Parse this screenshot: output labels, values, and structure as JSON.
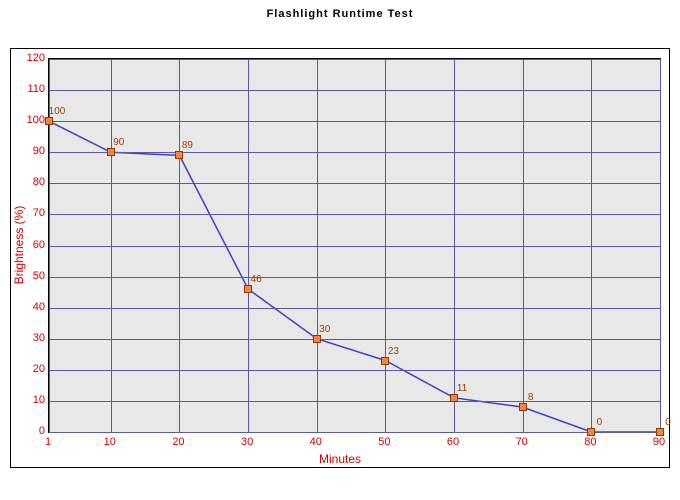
{
  "chart_data": {
    "type": "line",
    "title": "Flashlight Runtime Test",
    "xlabel": "Minutes",
    "ylabel": "Brightness (%)",
    "xlim": [
      1,
      90
    ],
    "ylim": [
      0,
      120
    ],
    "xticks": [
      1,
      10,
      20,
      30,
      40,
      50,
      60,
      70,
      80,
      90
    ],
    "yticks": [
      0,
      10,
      20,
      30,
      40,
      50,
      60,
      70,
      80,
      90,
      100,
      110,
      120
    ],
    "x": [
      1,
      10,
      20,
      30,
      40,
      50,
      60,
      70,
      80,
      90
    ],
    "values": [
      100,
      90,
      89,
      46,
      30,
      23,
      11,
      8,
      0,
      0
    ],
    "data_labels": [
      "100",
      "90",
      "89",
      "46",
      "30",
      "23",
      "11",
      "8",
      "0",
      "0"
    ]
  }
}
